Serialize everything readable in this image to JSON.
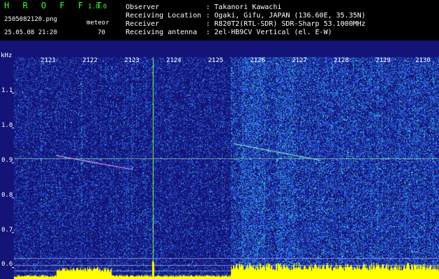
{
  "header": {
    "app_name": "H R O F F T",
    "version": "1.0.0",
    "filename": "2505082120.png",
    "timestamp": "25.05.08 21:20",
    "meteor_label": "meteor",
    "meteor_count": "70",
    "info": [
      {
        "label": "Observer",
        "value": ": Takanori Kawachi"
      },
      {
        "label": "Receiving Location",
        "value": ": Ogaki, Gifu, JAPAN (136.60E, 35.35N)"
      },
      {
        "label": "Receiver",
        "value": ": R820T2(RTL-SDR) SDR-Sharp 53.1000MHz"
      },
      {
        "label": "Receiving antenna",
        "value": ": 2el-HB9CV Vertical (el. E-W)"
      }
    ]
  },
  "spectrogram": {
    "unit": "kHz",
    "x_ticks": [
      "2121",
      "2122",
      "2123",
      "2124",
      "2125",
      "2126",
      "2127",
      "2128",
      "2129",
      "2130"
    ],
    "y_ticks": [
      "1.1",
      "1.0",
      "0.9",
      "0.8",
      "0.7",
      "0.6"
    ],
    "colors": {
      "background": "#141478",
      "noise": "#2d6cf0",
      "hot": "#40e0c0",
      "peak": "#ffff00",
      "carrier": "#a0ffb0"
    }
  }
}
